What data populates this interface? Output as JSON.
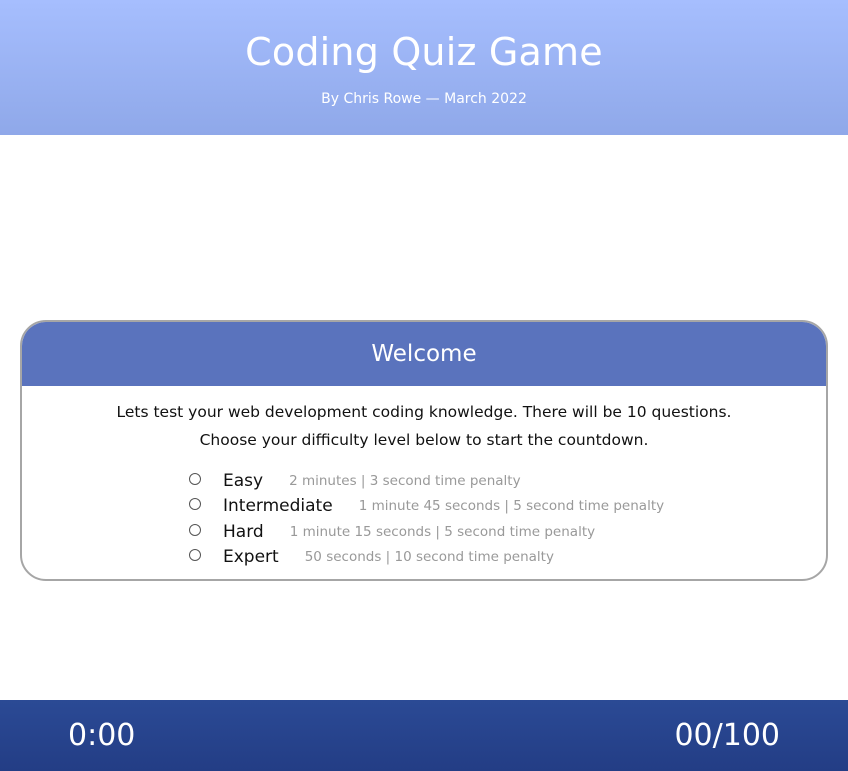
{
  "header": {
    "title": "Coding Quiz Game",
    "subtitle": "By Chris Rowe — March 2022"
  },
  "welcome": {
    "title": "Welcome",
    "intro_line1": "Lets test your web development coding knowledge. There will be 10 questions.",
    "intro_line2": "Choose your difficulty level below to start the countdown.",
    "options": [
      {
        "label": "Easy",
        "description": "2 minutes | 3 second time penalty",
        "selected": false
      },
      {
        "label": "Intermediate",
        "description": "1 minute 45 seconds | 5 second time penalty",
        "selected": false
      },
      {
        "label": "Hard",
        "description": "1 minute 15 seconds | 5 second time penalty",
        "selected": false
      },
      {
        "label": "Expert",
        "description": "50 seconds | 10 second time penalty",
        "selected": false
      }
    ]
  },
  "footer": {
    "timer": "0:00",
    "score": "00/100"
  },
  "colors": {
    "header_top": "#a6befe",
    "header_bottom": "#8fa8e9",
    "card_header": "#5a73bd",
    "footer": "#2b4a95",
    "description_text": "#999999"
  }
}
